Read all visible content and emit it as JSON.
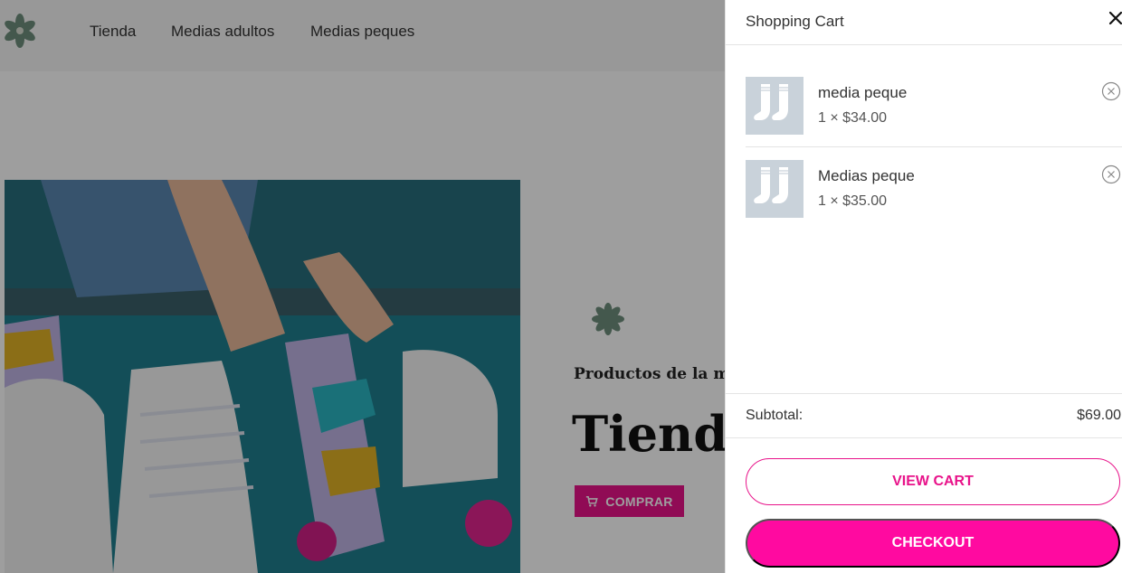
{
  "nav": {
    "items": [
      "Tienda",
      "Medias adultos",
      "Medias peques"
    ]
  },
  "hero": {
    "subtitle": "Productos de la mej",
    "title": "Tienda",
    "button_label": "COMPRAR"
  },
  "cart": {
    "title": "Shopping Cart",
    "items": [
      {
        "name": "media peque",
        "qty_price": "1 × $34.00"
      },
      {
        "name": "Medias peque",
        "qty_price": "1 × $35.00"
      }
    ],
    "subtotal_label": "Subtotal:",
    "subtotal_value": "$69.00",
    "view_cart_label": "VIEW CART",
    "checkout_label": "CHECKOUT"
  },
  "colors": {
    "accent": "#e8138a",
    "checkout_bg": "#ff0aa0",
    "logo_green": "#6f8f7c"
  },
  "icons": {
    "logo": "flower-icon",
    "close": "close-icon",
    "remove": "remove-circle-icon",
    "cart": "cart-icon"
  }
}
